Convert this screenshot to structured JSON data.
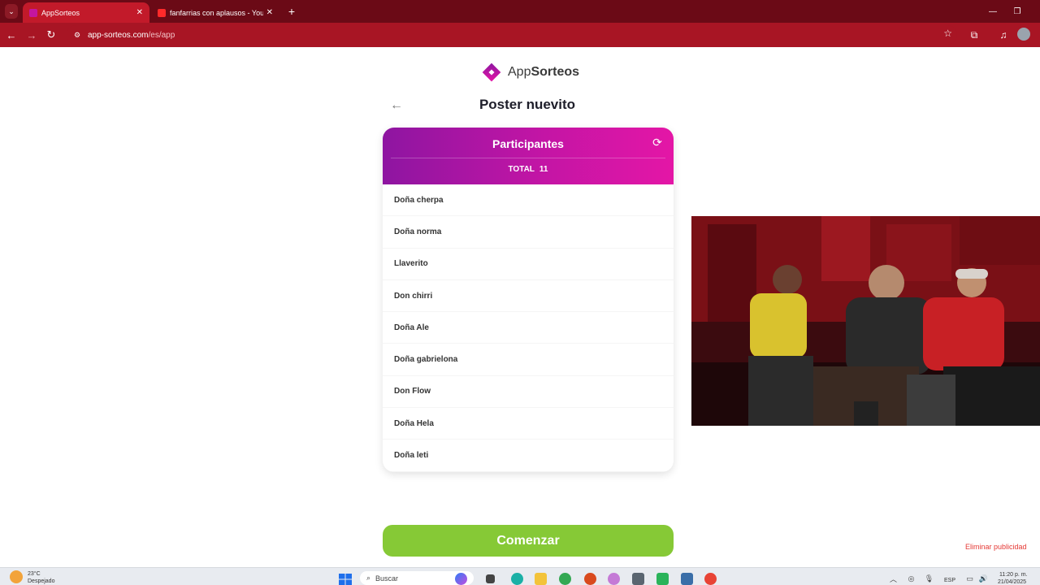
{
  "browser": {
    "tabs": [
      {
        "label": "AppSorteos",
        "active": true,
        "favicon": "appsorteos-favicon"
      },
      {
        "label": "fanfarrias con aplausos - YouTu",
        "active": false,
        "favicon": "youtube-favicon"
      }
    ],
    "url_host": "app-sorteos.com",
    "url_path": "/es/app",
    "accent_color": "#a81524"
  },
  "page": {
    "logo_prefix": "App",
    "logo_suffix": "Sorteos",
    "title": "Poster nuevito",
    "card": {
      "title": "Participantes",
      "total_label": "TOTAL",
      "total_value": "11",
      "participants": [
        "Doña cherpa",
        "Doña norma",
        "Llaverito",
        "Don chirri",
        "Doña Ale",
        "Doña gabrielona",
        "Don Flow",
        "Doña Hela",
        "Doña leti"
      ]
    },
    "start_button": "Comenzar",
    "remove_ads": "Eliminar publicidad",
    "colors": {
      "header_gradient_start": "#8e15a1",
      "header_gradient_end": "#e416a6",
      "start_button": "#86c936"
    }
  },
  "taskbar": {
    "weather_temp": "23°C",
    "weather_desc": "Despejado",
    "search_placeholder": "Buscar",
    "language": "ESP",
    "time": "11:20 p. m.",
    "date": "21/04/2025"
  }
}
